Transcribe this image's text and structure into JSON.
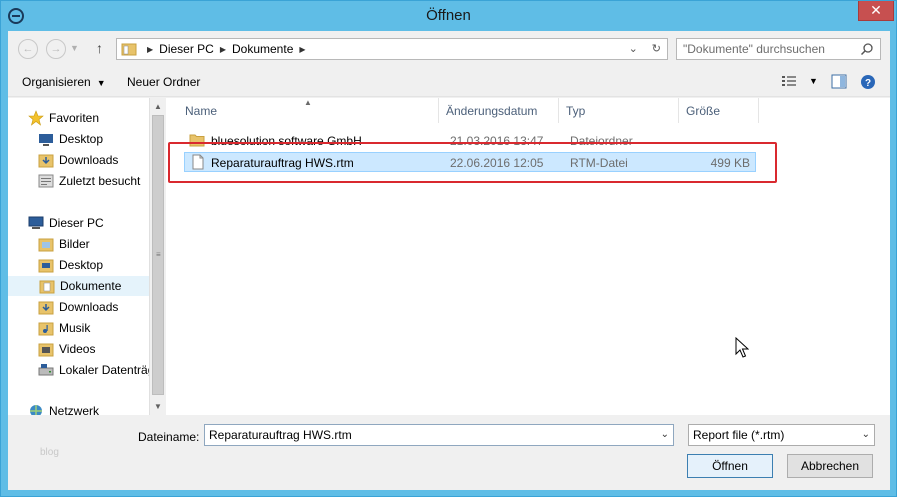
{
  "window": {
    "title": "Öffnen",
    "close_label": "✕"
  },
  "address": {
    "crumbs": [
      "Dieser PC",
      "Dokumente"
    ]
  },
  "search": {
    "placeholder": "\"Dokumente\" durchsuchen"
  },
  "toolbar": {
    "organize_label": "Organisieren",
    "new_folder_label": "Neuer Ordner"
  },
  "navpane": {
    "items": [
      {
        "label": "Favoriten",
        "icon": "star-icon"
      },
      {
        "label": "Desktop",
        "icon": "desktop-icon"
      },
      {
        "label": "Downloads",
        "icon": "downloads-icon"
      },
      {
        "label": "Zuletzt besucht",
        "icon": "recent-icon"
      },
      {
        "label": "Dieser PC",
        "icon": "computer-icon"
      },
      {
        "label": "Bilder",
        "icon": "pictures-icon"
      },
      {
        "label": "Desktop",
        "icon": "desktop-folder-icon"
      },
      {
        "label": "Dokumente",
        "icon": "documents-icon"
      },
      {
        "label": "Downloads",
        "icon": "downloads-icon"
      },
      {
        "label": "Musik",
        "icon": "music-icon"
      },
      {
        "label": "Videos",
        "icon": "videos-icon"
      },
      {
        "label": "Lokaler Datenträger",
        "icon": "drive-icon"
      },
      {
        "label": "Netzwerk",
        "icon": "network-icon"
      }
    ],
    "selected": "Dokumente"
  },
  "filelist": {
    "columns": [
      "Name",
      "Änderungsdatum",
      "Typ",
      "Größe"
    ],
    "rows": [
      {
        "name": "bluesolution software GmbH",
        "date": "21.03.2016 13:47",
        "type": "Dateiordner",
        "size": "",
        "icon": "folder-icon"
      },
      {
        "name": "Reparaturauftrag HWS.rtm",
        "date": "22.06.2016 12:05",
        "type": "RTM-Datei",
        "size": "499 KB",
        "icon": "file-icon"
      }
    ]
  },
  "bottom": {
    "filename_label": "Dateiname:",
    "filename_value": "Reparaturauftrag HWS.rtm",
    "filetype_value": "Report file (*.rtm)",
    "open_label": "Öffnen",
    "cancel_label": "Abbrechen",
    "faint_text": "blog"
  },
  "colors": {
    "frame": "#5fbde6",
    "close": "#c75050",
    "selection": "#cce8ff",
    "highlight": "#d9292f"
  }
}
